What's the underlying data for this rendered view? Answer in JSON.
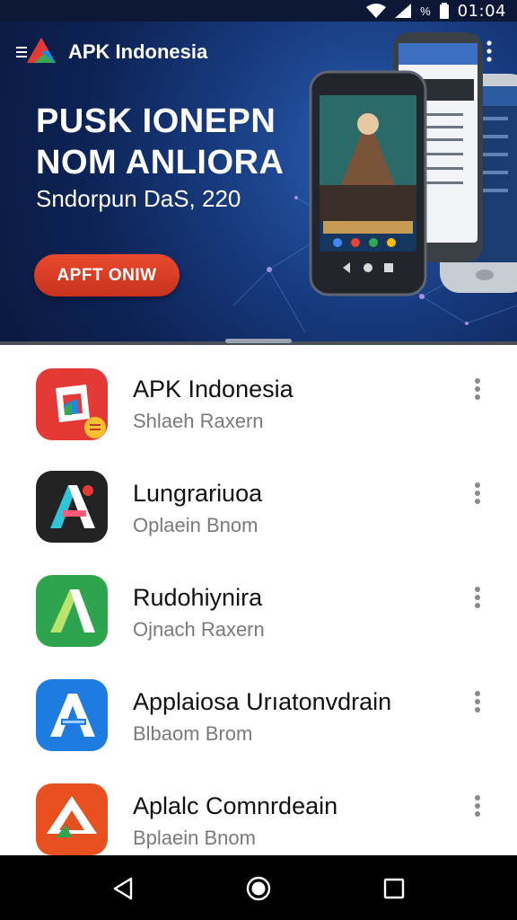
{
  "status_bar": {
    "time": "01:04",
    "battery_label": "%"
  },
  "app_bar": {
    "title": "APK Indonesia"
  },
  "hero": {
    "headline_line1": "PUSK IONEPN",
    "headline_line2": "NOM ANLIORA",
    "subtitle": "Sndorpun DaS, 220",
    "cta_label": "APFT ONIW"
  },
  "apps": [
    {
      "name": "APK Indonesia",
      "subtitle": "Shlaeh Raxern",
      "icon": "apk-indonesia-icon",
      "color": "#e53935"
    },
    {
      "name": "Lungrariuoa",
      "subtitle": "Oplaein Bnom",
      "icon": "lungrariuoa-icon",
      "color": "#222222"
    },
    {
      "name": "Rudohiynira",
      "subtitle": "Ojnach Raxern",
      "icon": "rudohiynira-icon",
      "color": "#2ea44f"
    },
    {
      "name": "Applaiosa Urıatonvdrain",
      "subtitle": "Blbaom Brom",
      "icon": "applaiosa-icon",
      "color": "#1e7be0"
    },
    {
      "name": "Aplalc Comnrdeain",
      "subtitle": "Bplaein Bnom",
      "icon": "aplalc-icon",
      "color": "#e8501f"
    }
  ]
}
